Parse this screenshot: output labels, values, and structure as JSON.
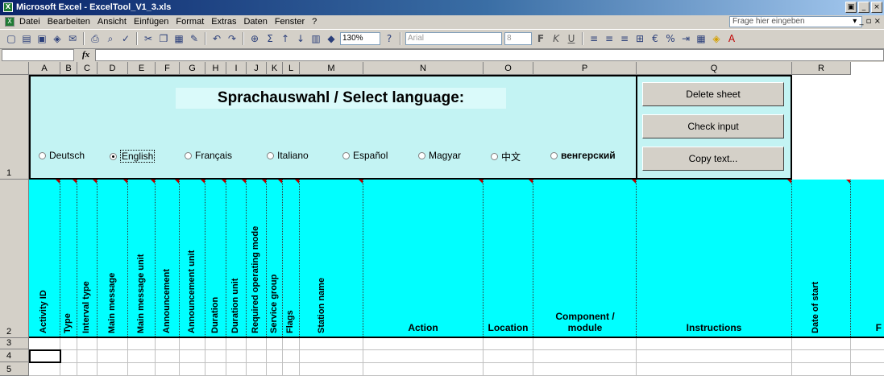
{
  "window": {
    "title": "Microsoft Excel - ExcelTool_V1_3.xls",
    "app_icon": "excel-icon",
    "controls": [
      "_",
      "□",
      "×"
    ]
  },
  "menubar": {
    "items": [
      "Datei",
      "Bearbeiten",
      "Ansicht",
      "Einfügen",
      "Format",
      "Extras",
      "Daten",
      "Fenster",
      "?"
    ],
    "help_placeholder": "Frage hier eingeben",
    "doc_controls": "▾ _ ▫ ×"
  },
  "toolbar": {
    "zoom": "130%",
    "font": "Arial",
    "font_size": "8",
    "bold": "F",
    "italic": "K",
    "underline": "U"
  },
  "formulabar": {
    "fx": "fx",
    "namebox": "",
    "formula": ""
  },
  "columns": [
    "A",
    "B",
    "C",
    "D",
    "E",
    "F",
    "G",
    "H",
    "I",
    "J",
    "K",
    "L",
    "M",
    "N",
    "O",
    "P",
    "Q",
    "R"
  ],
  "rows": [
    "1",
    "2",
    "3",
    "4",
    "5"
  ],
  "language_panel": {
    "title": "Sprachauswahl / Select language:",
    "options": [
      {
        "label": "Deutsch",
        "selected": false
      },
      {
        "label": "English",
        "selected": true
      },
      {
        "label": "Français",
        "selected": false
      },
      {
        "label": "Italiano",
        "selected": false
      },
      {
        "label": "Español",
        "selected": false
      },
      {
        "label": "Magyar",
        "selected": false
      },
      {
        "label": "中文",
        "selected": false
      },
      {
        "label": "венгерский",
        "selected": false
      }
    ]
  },
  "buttons": {
    "delete_sheet": "Delete sheet",
    "check_input": "Check input",
    "copy_text": "Copy text..."
  },
  "headers": {
    "activity_id": "Activity ID",
    "type": "Type",
    "interval_type": "Interval type",
    "main_message": "Main message",
    "main_message_unit": "Main message unit",
    "announcement": "Announcement",
    "announcement_unit": "Announcement unit",
    "duration": "Duration",
    "duration_unit": "Duration unit",
    "required_operating_mode": "Required operating mode",
    "service_group": "Service group",
    "flags": "Flags",
    "station_name": "Station name",
    "action": "Action",
    "location": "Location",
    "component_module": "Component / module",
    "instructions": "Instructions",
    "date_of_start": "Date of start",
    "next_partial": "F"
  },
  "colors": {
    "panel_bg": "#c3f3f3",
    "header_bg": "#00ffff",
    "titlebar": "#0a246a"
  }
}
